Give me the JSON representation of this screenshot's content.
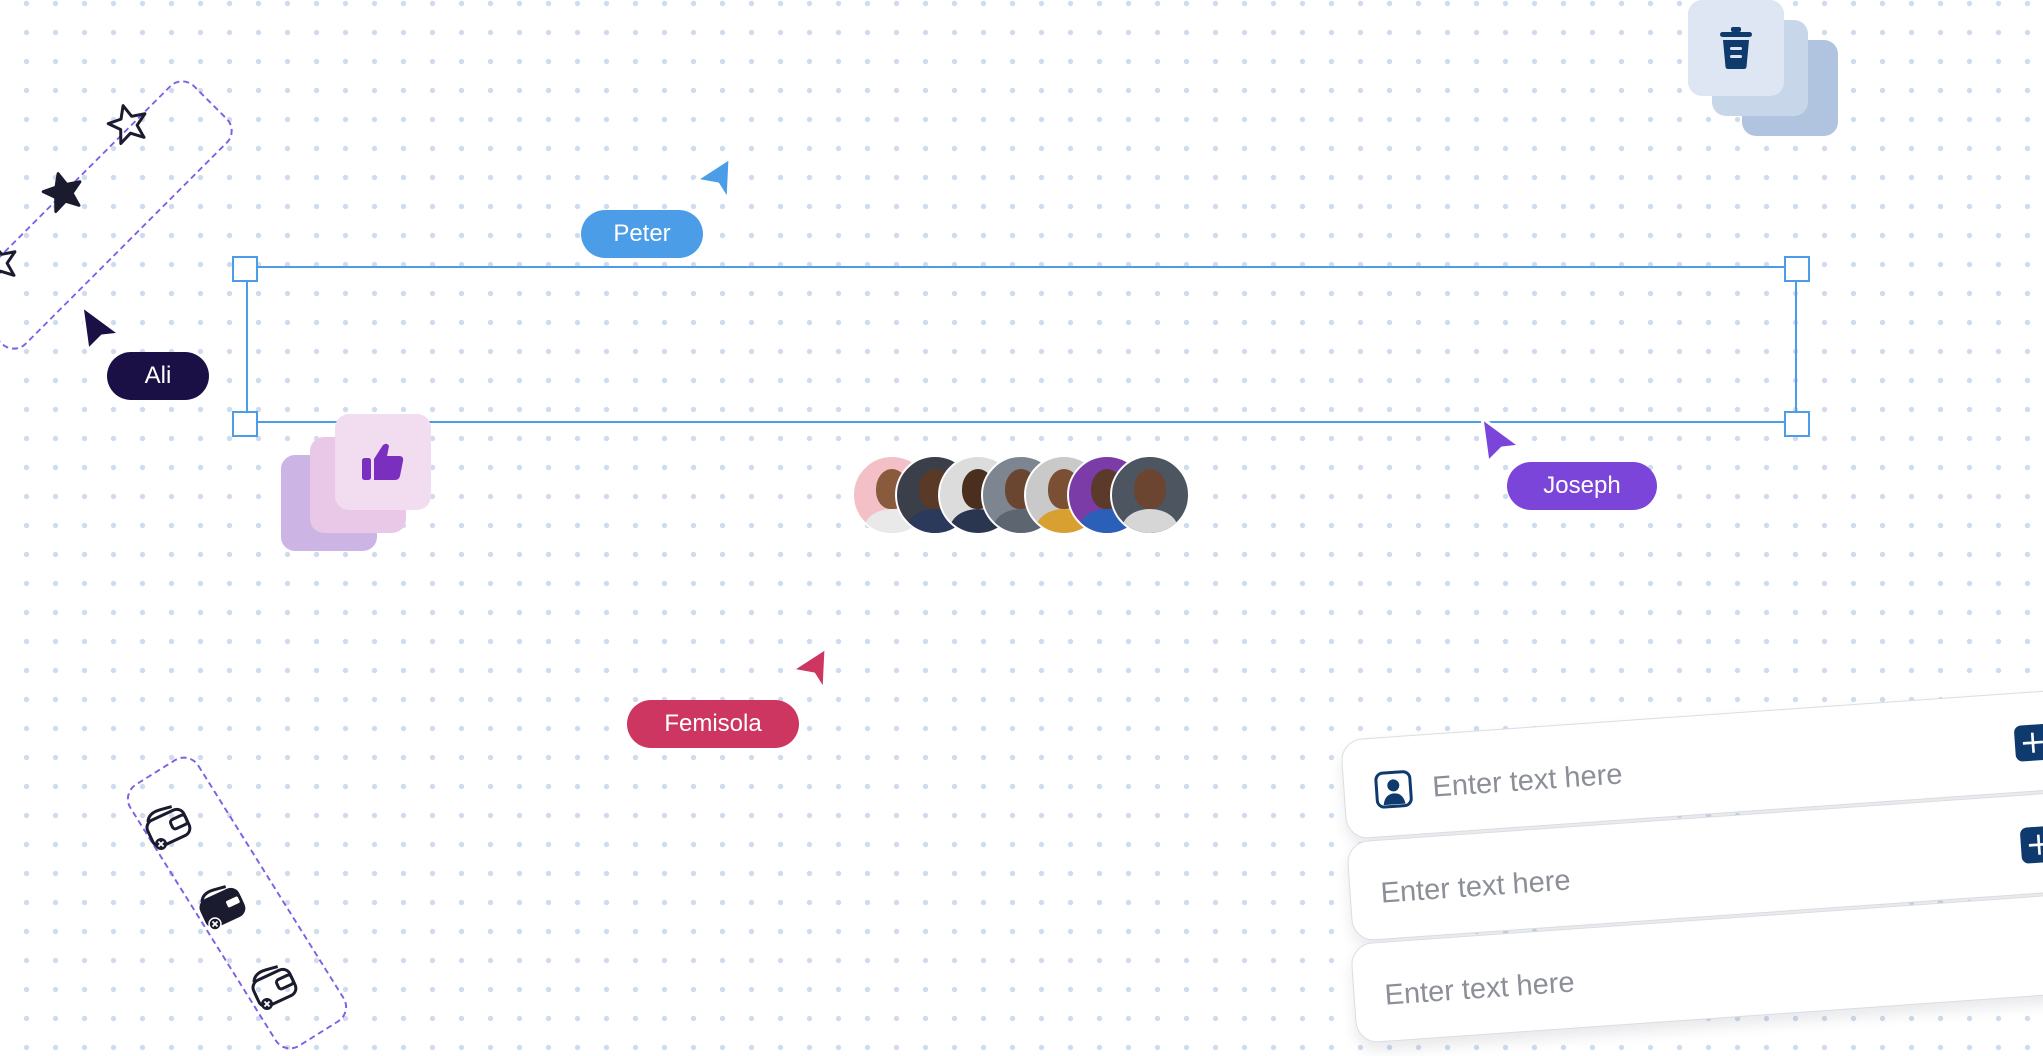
{
  "collaborators": [
    {
      "name": "Peter",
      "color": "#4a9de6"
    },
    {
      "name": "Ali",
      "color": "#1a1045"
    },
    {
      "name": "Joseph",
      "color": "#7b45d9"
    },
    {
      "name": "Femisola",
      "color": "#cc3660"
    }
  ],
  "avatar_group": [
    {
      "name": "avatar-1",
      "bg": "#f3c0c8",
      "skin": "#8a5a3c",
      "shirt": "#e9e9e9"
    },
    {
      "name": "avatar-2",
      "bg": "#3a3f4a",
      "skin": "#5a3a26",
      "shirt": "#2b3a5a"
    },
    {
      "name": "avatar-3",
      "bg": "#dcdcdc",
      "skin": "#4a2e1e",
      "shirt": "#2a3550"
    },
    {
      "name": "avatar-4",
      "bg": "#7d8690",
      "skin": "#6a4530",
      "shirt": "#5d6670"
    },
    {
      "name": "avatar-5",
      "bg": "#c9c9c9",
      "skin": "#7a4f34",
      "shirt": "#d8a030"
    },
    {
      "name": "avatar-6",
      "bg": "#7c3ca8",
      "skin": "#5b3a2c",
      "shirt": "#2a60b8"
    },
    {
      "name": "avatar-7",
      "bg": "#4d5560",
      "skin": "#6b4530",
      "shirt": "#d6d6d6"
    }
  ],
  "inputs": [
    {
      "placeholder": "Enter text here",
      "icon": "user-square-icon",
      "action": "+"
    },
    {
      "placeholder": "Enter text here",
      "action": "+"
    },
    {
      "placeholder": "Enter text here"
    }
  ],
  "icons": {
    "trash": "trash-icon",
    "thumbs_up": "thumbs-up-icon",
    "star_outline": "star-outline-icon",
    "star_filled": "star-filled-icon",
    "wallet_remove": "wallet-remove-icon"
  },
  "colors": {
    "selection": "#4a9de6",
    "dash": "#7d62e6",
    "trash_card": "#dde6f2",
    "like_card": "#f2dcf0",
    "plus_button": "#0f3a6e"
  }
}
